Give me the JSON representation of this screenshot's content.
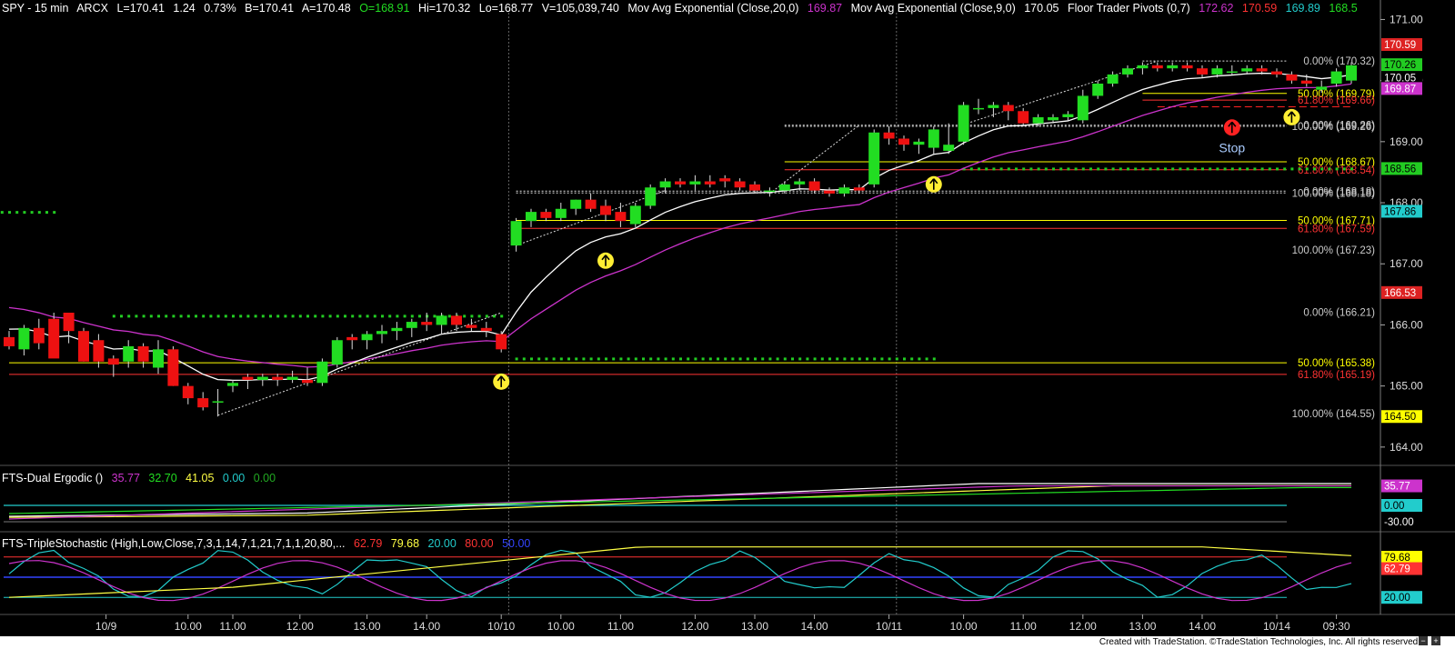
{
  "colors": {
    "background": "#000000",
    "up_candle": "#22dd22",
    "down_candle": "#ee1111",
    "ema20": "#cc33cc",
    "ema9": "#ffffff",
    "fib_50": "#ffff00",
    "fib_618": "#ff3333",
    "pivot_dots": "#22cc22",
    "stop": "#ff2222",
    "signal_up": "#ffee33"
  },
  "header": {
    "symbol": "SPY - 15 min",
    "exchange": "ARCX",
    "last": "L=170.41",
    "change": "1.24",
    "change_pct": "0.73%",
    "bid": "B=170.41",
    "ask": "A=170.48",
    "open": "O=168.91",
    "high": "Hi=170.32",
    "low": "Lo=168.77",
    "volume": "V=105,039,740",
    "ema20_label": "Mov Avg Exponential (Close,20,0)",
    "ema20_value": "169.87",
    "ema9_label": "Mov Avg Exponential (Close,9,0)",
    "ema9_value": "170.05",
    "pivots_label": "Floor Trader Pivots (0,7)",
    "pivots_v1": "172.62",
    "pivots_v2": "170.59",
    "pivots_v3": "169.89",
    "pivots_v4": "168.5"
  },
  "ergodic": {
    "label": "FTS-Dual Ergodic ()",
    "v1": "35.77",
    "v2": "32.70",
    "v3": "41.05",
    "v4": "0.00",
    "v5": "0.00",
    "axis_labels": [
      "35.77",
      "0.00",
      "-30.00"
    ]
  },
  "stochastic": {
    "label": "FTS-TripleStochastic (High,Low,Close,7,3,1,14,7,1,21,7,1,1,20,80,...",
    "v1": "62.79",
    "v2": "79.68",
    "v3": "20.00",
    "v4": "80.00",
    "v5": "50.00",
    "axis_labels": [
      "79.68",
      "62.79",
      "20.00"
    ]
  },
  "footer": "Created with TradeStation. ©TradeStation Technologies, Inc. All rights reserved.",
  "chart_data": {
    "type": "candlestick",
    "symbol": "SPY",
    "interval": "15 min",
    "ylim": [
      163.7,
      171.2
    ],
    "y_ticks": [
      164.0,
      165.0,
      166.0,
      167.0,
      168.0,
      169.0,
      170.0,
      171.0
    ],
    "x_labels": [
      "10/9",
      "10.00",
      "11.00",
      "12.00",
      "13.00",
      "14.00",
      "10/10",
      "10.00",
      "11.00",
      "12.00",
      "13.00",
      "14.00",
      "10/11",
      "10.00",
      "11.00",
      "12.00",
      "13.00",
      "14.00",
      "10/14",
      "09:30"
    ],
    "price_flags": [
      {
        "value": 170.59,
        "label": "170.59",
        "color": "#dd2222",
        "text": "#ffffff"
      },
      {
        "value": 170.26,
        "label": "170.26",
        "color": "#22cc22",
        "text": "#000000"
      },
      {
        "value": 170.05,
        "label": "170.05",
        "color": "#000000",
        "text": "#ffffff"
      },
      {
        "value": 169.87,
        "label": "169.87",
        "color": "#cc33cc",
        "text": "#ffffff"
      },
      {
        "value": 168.56,
        "label": "168.56",
        "color": "#22cc22",
        "text": "#000000"
      },
      {
        "value": 167.86,
        "label": "167.86",
        "color": "#22cccc",
        "text": "#000000"
      },
      {
        "value": 166.53,
        "label": "166.53",
        "color": "#dd2222",
        "text": "#ffffff"
      },
      {
        "value": 164.5,
        "label": "164.50",
        "color": "#ffff00",
        "text": "#000000"
      }
    ],
    "candles": [
      [
        165.8,
        165.9,
        165.6,
        165.65
      ],
      [
        165.6,
        166.0,
        165.5,
        165.95
      ],
      [
        165.95,
        166.1,
        165.6,
        165.7
      ],
      [
        166.1,
        166.2,
        165.7,
        165.45
      ],
      [
        166.2,
        166.2,
        165.7,
        165.9
      ],
      [
        165.9,
        165.95,
        165.4,
        165.4
      ],
      [
        165.75,
        165.85,
        165.3,
        165.4
      ],
      [
        165.45,
        165.5,
        165.15,
        165.35
      ],
      [
        165.4,
        165.75,
        165.3,
        165.65
      ],
      [
        165.65,
        165.7,
        165.3,
        165.4
      ],
      [
        165.3,
        165.75,
        165.2,
        165.6
      ],
      [
        165.6,
        165.65,
        165.0,
        165.0
      ],
      [
        165.0,
        165.05,
        164.7,
        164.8
      ],
      [
        164.8,
        164.9,
        164.6,
        164.65
      ],
      [
        164.75,
        164.95,
        164.5,
        164.75
      ],
      [
        165.0,
        165.1,
        164.9,
        165.05
      ],
      [
        165.15,
        165.2,
        164.95,
        165.1
      ],
      [
        165.1,
        165.2,
        165.0,
        165.15
      ],
      [
        165.15,
        165.2,
        165.0,
        165.1
      ],
      [
        165.1,
        165.25,
        165.05,
        165.15
      ],
      [
        165.1,
        165.3,
        165.0,
        165.05
      ],
      [
        165.05,
        165.45,
        165.0,
        165.4
      ],
      [
        165.35,
        165.8,
        165.3,
        165.75
      ],
      [
        165.8,
        165.85,
        165.6,
        165.75
      ],
      [
        165.75,
        165.9,
        165.6,
        165.85
      ],
      [
        165.85,
        166.0,
        165.7,
        165.9
      ],
      [
        165.9,
        166.05,
        165.75,
        165.95
      ],
      [
        165.95,
        166.1,
        165.8,
        166.05
      ],
      [
        166.05,
        166.2,
        165.9,
        166.0
      ],
      [
        166.0,
        166.2,
        165.85,
        166.15
      ],
      [
        166.15,
        166.2,
        165.9,
        166.0
      ],
      [
        166.0,
        166.1,
        165.9,
        165.95
      ],
      [
        165.95,
        166.05,
        165.8,
        165.9
      ],
      [
        165.85,
        165.9,
        165.55,
        165.6
      ],
      [
        167.3,
        167.75,
        167.2,
        167.7
      ],
      [
        167.7,
        167.9,
        167.6,
        167.85
      ],
      [
        167.85,
        167.9,
        167.7,
        167.75
      ],
      [
        167.75,
        168.0,
        167.7,
        167.9
      ],
      [
        167.9,
        168.05,
        167.8,
        168.05
      ],
      [
        168.05,
        168.15,
        167.85,
        167.9
      ],
      [
        167.95,
        168.05,
        167.7,
        167.8
      ],
      [
        167.85,
        168.0,
        167.6,
        167.7
      ],
      [
        167.65,
        168.0,
        167.6,
        167.95
      ],
      [
        167.95,
        168.3,
        167.9,
        168.25
      ],
      [
        168.25,
        168.4,
        168.15,
        168.35
      ],
      [
        168.35,
        168.4,
        168.25,
        168.3
      ],
      [
        168.3,
        168.45,
        168.2,
        168.35
      ],
      [
        168.35,
        168.45,
        168.25,
        168.3
      ],
      [
        168.4,
        168.45,
        168.25,
        168.35
      ],
      [
        168.35,
        168.4,
        168.2,
        168.25
      ],
      [
        168.3,
        168.35,
        168.15,
        168.2
      ],
      [
        168.2,
        168.25,
        168.1,
        168.2
      ],
      [
        168.2,
        168.35,
        168.15,
        168.3
      ],
      [
        168.3,
        168.4,
        168.2,
        168.35
      ],
      [
        168.35,
        168.4,
        168.15,
        168.2
      ],
      [
        168.2,
        168.25,
        168.1,
        168.15
      ],
      [
        168.15,
        168.3,
        168.1,
        168.25
      ],
      [
        168.25,
        168.3,
        168.15,
        168.2
      ],
      [
        168.3,
        169.2,
        168.25,
        169.15
      ],
      [
        169.15,
        169.25,
        168.95,
        169.05
      ],
      [
        169.05,
        169.1,
        168.85,
        168.95
      ],
      [
        168.95,
        169.05,
        168.8,
        169.0
      ],
      [
        168.9,
        169.25,
        168.8,
        169.2
      ],
      [
        168.85,
        169.3,
        168.8,
        168.95
      ],
      [
        169.0,
        169.65,
        168.95,
        169.6
      ],
      [
        169.55,
        169.7,
        169.45,
        169.55
      ],
      [
        169.55,
        169.65,
        169.4,
        169.6
      ],
      [
        169.6,
        169.65,
        169.35,
        169.5
      ],
      [
        169.5,
        169.55,
        169.25,
        169.3
      ],
      [
        169.3,
        169.45,
        169.25,
        169.4
      ],
      [
        169.35,
        169.45,
        169.3,
        169.4
      ],
      [
        169.4,
        169.5,
        169.35,
        169.45
      ],
      [
        169.35,
        169.85,
        169.3,
        169.75
      ],
      [
        169.75,
        170.0,
        169.7,
        169.95
      ],
      [
        169.95,
        170.15,
        169.9,
        170.1
      ],
      [
        170.1,
        170.25,
        170.05,
        170.2
      ],
      [
        170.2,
        170.3,
        170.1,
        170.25
      ],
      [
        170.25,
        170.3,
        170.15,
        170.2
      ],
      [
        170.2,
        170.3,
        170.15,
        170.25
      ],
      [
        170.25,
        170.3,
        170.15,
        170.2
      ],
      [
        170.2,
        170.25,
        170.05,
        170.1
      ],
      [
        170.1,
        170.25,
        170.05,
        170.2
      ],
      [
        170.15,
        170.25,
        170.1,
        170.15
      ],
      [
        170.15,
        170.25,
        170.1,
        170.2
      ],
      [
        170.2,
        170.25,
        170.1,
        170.15
      ],
      [
        170.15,
        170.2,
        170.05,
        170.1
      ],
      [
        170.1,
        170.15,
        169.95,
        170.0
      ],
      [
        170.0,
        170.1,
        169.9,
        169.95
      ],
      [
        169.85,
        170.0,
        169.8,
        169.9
      ],
      [
        169.95,
        170.2,
        169.9,
        170.15
      ],
      [
        170.0,
        170.3,
        169.95,
        170.25
      ]
    ],
    "fib_levels": [
      {
        "label": "0.00% (170.32)",
        "value": 170.32,
        "color": "#dddddd",
        "x_from_bar": 76
      },
      {
        "label": "50.00% (169.79)",
        "value": 169.79,
        "color": "#ffff00",
        "x_from_bar": 76
      },
      {
        "label": "61.80% (169.66)",
        "value": 169.68,
        "color": "#ff3333",
        "x_from_bar": 76
      },
      {
        "label": "100.00% (169.26)",
        "value": 169.25,
        "color": "#dddddd",
        "x_from_bar": 52
      },
      {
        "label": "0.00% (169.26)",
        "value": 169.27,
        "color": "#dddddd",
        "x_from_bar": 52
      },
      {
        "label": "50.00% (168.67)",
        "value": 168.67,
        "color": "#ffff00",
        "x_from_bar": 52
      },
      {
        "label": "61.80% (168.54)",
        "value": 168.54,
        "color": "#ff3333",
        "x_from_bar": 52
      },
      {
        "label": "100.00% (168.18)",
        "value": 168.16,
        "color": "#dddddd",
        "x_from_bar": 34
      },
      {
        "label": "0.00% (168.18)",
        "value": 168.19,
        "color": "#dddddd",
        "x_from_bar": 34
      },
      {
        "label": "50.00% (167.71)",
        "value": 167.71,
        "color": "#ffff00",
        "x_from_bar": 34
      },
      {
        "label": "61.80% (167.59)",
        "value": 167.58,
        "color": "#ff3333",
        "x_from_bar": 34
      },
      {
        "label": "100.00% (167.23)",
        "value": 167.23,
        "color": "#dddddd",
        "x_from_bar": null
      },
      {
        "label": "0.00% (166.21)",
        "value": 166.21,
        "color": "#dddddd",
        "x_from_bar": null
      },
      {
        "label": "50.00% (165.38)",
        "value": 165.38,
        "color": "#ffff00",
        "x_from_bar": 0
      },
      {
        "label": "61.80% (165.19)",
        "value": 165.19,
        "color": "#ff3333",
        "x_from_bar": 0
      },
      {
        "label": "100.00% (164.55)",
        "value": 164.55,
        "color": "#dddddd",
        "x_from_bar": null
      }
    ],
    "pivot_dot_rows": [
      {
        "value": 167.85,
        "from_bar": -1,
        "to_bar": 3
      },
      {
        "value": 166.15,
        "from_bar": 7,
        "to_bar": 33
      },
      {
        "value": 165.45,
        "from_bar": 34,
        "to_bar": 62
      },
      {
        "value": 168.56,
        "from_bar": 64,
        "to_bar": 90
      }
    ],
    "signals": [
      {
        "bar": 33,
        "value": 165.22,
        "type": "up"
      },
      {
        "bar": 40,
        "value": 167.2,
        "type": "up"
      },
      {
        "bar": 62,
        "value": 168.45,
        "type": "up"
      },
      {
        "bar": 86,
        "value": 169.55,
        "type": "up"
      },
      {
        "bar": 82,
        "value": 169.38,
        "type": "stop"
      }
    ],
    "stop_label": "Stop",
    "stop_line": {
      "value": 169.57,
      "from_bar": 77,
      "to_bar": 90
    }
  }
}
